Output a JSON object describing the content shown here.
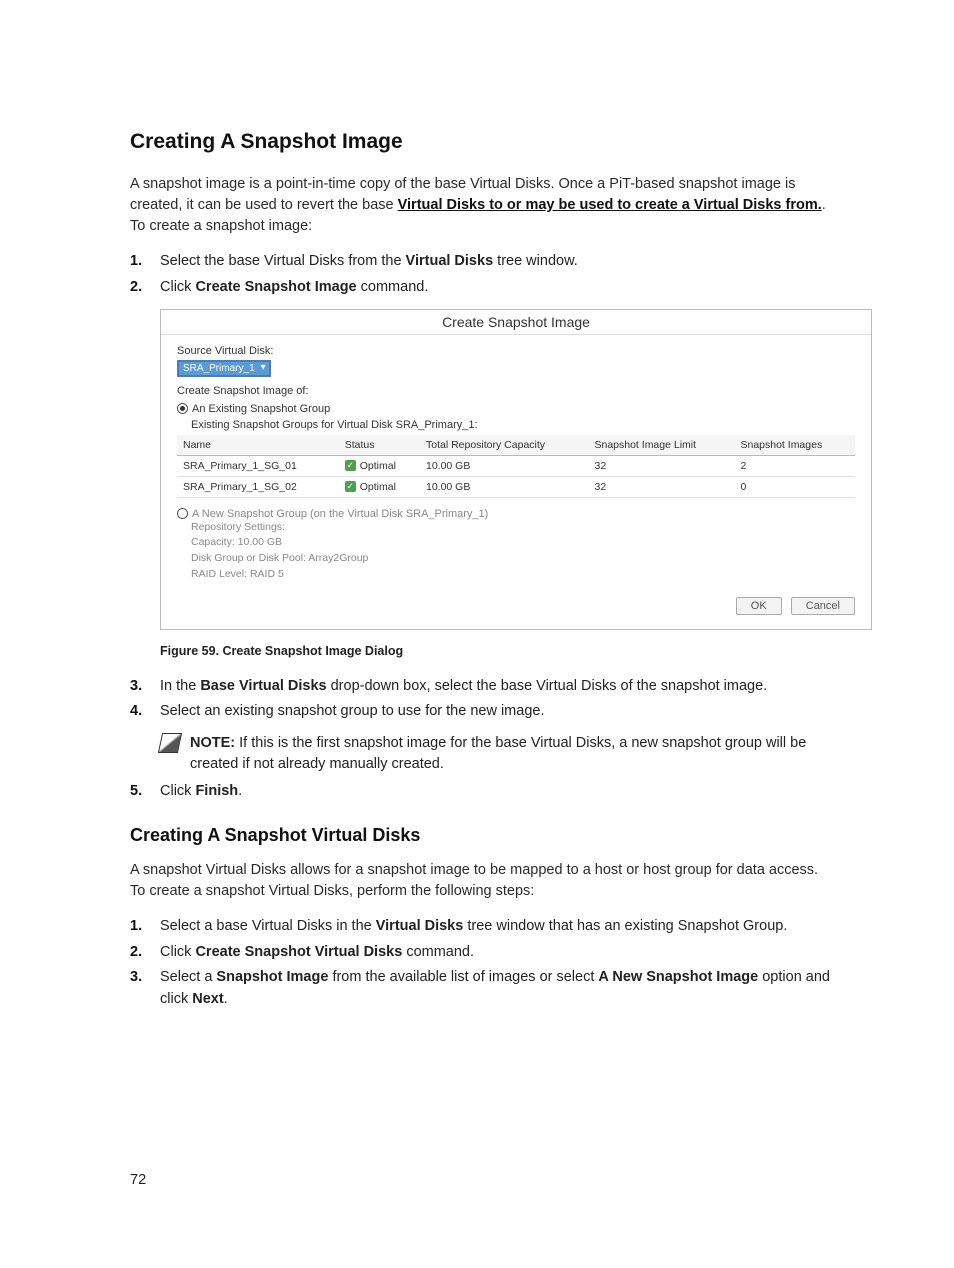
{
  "page_number": "72",
  "section1": {
    "title": "Creating A Snapshot Image",
    "intro_pre": "A snapshot image is a point-in-time copy of the base Virtual Disks. Once a PiT-based snapshot image is created, it can be used to revert the base ",
    "intro_link": "Virtual Disks to or may be used to create a Virtual Disks from.",
    "intro_post": ". To create a snapshot image:",
    "step1_pre": "Select the base Virtual Disks from the ",
    "step1_bold": "Virtual Disks",
    "step1_post": " tree window.",
    "step2_pre": "Click ",
    "step2_bold": "Create Snapshot Image",
    "step2_post": " command.",
    "step3_pre": "In the ",
    "step3_bold": "Base Virtual Disks",
    "step3_post": " drop-down box, select the base Virtual Disks of the snapshot image.",
    "step4": "Select an existing snapshot group to use for the new image.",
    "note_label": "NOTE:",
    "note_text": " If this is the first snapshot image for the base Virtual Disks, a new snapshot group will be created if not already manually created.",
    "step5_pre": "Click ",
    "step5_bold": "Finish",
    "step5_post": "."
  },
  "dialog": {
    "title": "Create Snapshot Image",
    "source_label": "Source Virtual Disk:",
    "source_value": "SRA_Primary_1",
    "create_of": "Create Snapshot Image of:",
    "radio_existing": "An Existing Snapshot Group",
    "existing_caption": "Existing Snapshot Groups for Virtual Disk SRA_Primary_1:",
    "cols": {
      "name": "Name",
      "status": "Status",
      "cap": "Total Repository Capacity",
      "limit": "Snapshot Image Limit",
      "imgs": "Snapshot Images"
    },
    "rows": [
      {
        "name": "SRA_Primary_1_SG_01",
        "status": "Optimal",
        "cap": "10.00 GB",
        "limit": "32",
        "imgs": "2"
      },
      {
        "name": "SRA_Primary_1_SG_02",
        "status": "Optimal",
        "cap": "10.00 GB",
        "limit": "32",
        "imgs": "0"
      }
    ],
    "radio_new": "A New Snapshot Group (on the Virtual Disk SRA_Primary_1)",
    "repo_title": "Repository Settings:",
    "repo_cap": "Capacity: 10.00 GB",
    "repo_dg": "Disk Group or Disk Pool: Array2Group",
    "repo_raid": "RAID Level: RAID 5",
    "ok": "OK",
    "cancel": "Cancel"
  },
  "fig_caption": "Figure 59. Create Snapshot Image Dialog",
  "section2": {
    "title": "Creating A Snapshot Virtual Disks",
    "intro": "A snapshot Virtual Disks allows for a snapshot image to be mapped to a host or host group for data access. To create a snapshot Virtual Disks, perform the following steps:",
    "s1_pre": "Select a base Virtual Disks in the ",
    "s1_bold": "Virtual Disks",
    "s1_post": " tree window that has an existing Snapshot Group.",
    "s2_pre": "Click ",
    "s2_bold": "Create Snapshot Virtual Disks",
    "s2_post": " command.",
    "s3_pre": "Select a ",
    "s3_b1": "Snapshot Image",
    "s3_mid": " from the available list of images or select ",
    "s3_b2": "A New Snapshot Image",
    "s3_post1": " option and click ",
    "s3_b3": "Next",
    "s3_post2": "."
  }
}
